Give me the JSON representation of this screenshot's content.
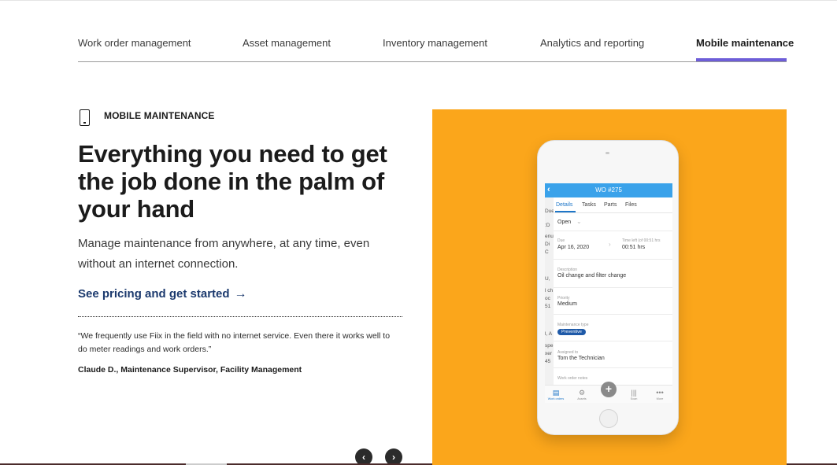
{
  "tabs": [
    {
      "label": "Work order management",
      "active": false
    },
    {
      "label": "Asset management",
      "active": false
    },
    {
      "label": "Inventory management",
      "active": false
    },
    {
      "label": "Analytics and reporting",
      "active": false
    },
    {
      "label": "Mobile maintenance",
      "active": true
    }
  ],
  "section": {
    "icon": "mobile-phone-icon",
    "label": "MOBILE MAINTENANCE",
    "headline": "Everything you need to get the job done in the palm of your hand",
    "lead": "Manage maintenance from anywhere, at any time, even without an internet connection.",
    "cta": "See pricing and get started",
    "cta_icon": "arrow-right-icon",
    "quote": "“We frequently use Fiix in the field with no internet service. Even there it works well to do meter readings and work orders.”",
    "attribution": "Claude D., Maintenance Supervisor, Facility Management"
  },
  "carousel": {
    "prev_icon": "chevron-left-icon",
    "next_icon": "chevron-right-icon",
    "prev_glyph": "‹",
    "next_glyph": "›"
  },
  "colors": {
    "accent_underline": "#6e5ed8",
    "visual_background": "#fba61b",
    "cta": "#1c3a6e",
    "app_header": "#3aa2ea",
    "badge": "#1f5aa8"
  },
  "phone": {
    "title": "WO #275",
    "tabs": [
      "Details",
      "Tasks",
      "Parts",
      "Files"
    ],
    "status": "Open",
    "due_label": "Due",
    "due_value": "Apr 16, 2020",
    "time_left_label": "Time left (of 00:51 hrs",
    "time_left_value": "00:51 hrs",
    "description_label": "Description",
    "description_value": "Oil change and filter change",
    "priority_label": "Priority",
    "priority_value": "Medium",
    "maintenance_type_label": "Maintenance type",
    "maintenance_type_value": "Preventive",
    "assigned_label": "Assigned to",
    "assigned_value": "Tom the Technician",
    "notes_label": "Work order notes",
    "strip_texts": [
      "Due",
      ":D",
      "enu",
      "Di",
      "C",
      "U,",
      "l ch",
      "oc",
      "51",
      "l, A",
      "spe",
      "xer",
      "45"
    ],
    "nav": [
      {
        "label": "Work orders",
        "icon": "clipboard-icon",
        "glyph": "▤"
      },
      {
        "label": "Assets",
        "icon": "assets-icon",
        "glyph": "⚙"
      },
      {
        "label": "Scan",
        "icon": "barcode-icon",
        "glyph": "|||"
      },
      {
        "label": "More",
        "icon": "more-icon",
        "glyph": "•••"
      }
    ],
    "fab_glyph": "+"
  }
}
